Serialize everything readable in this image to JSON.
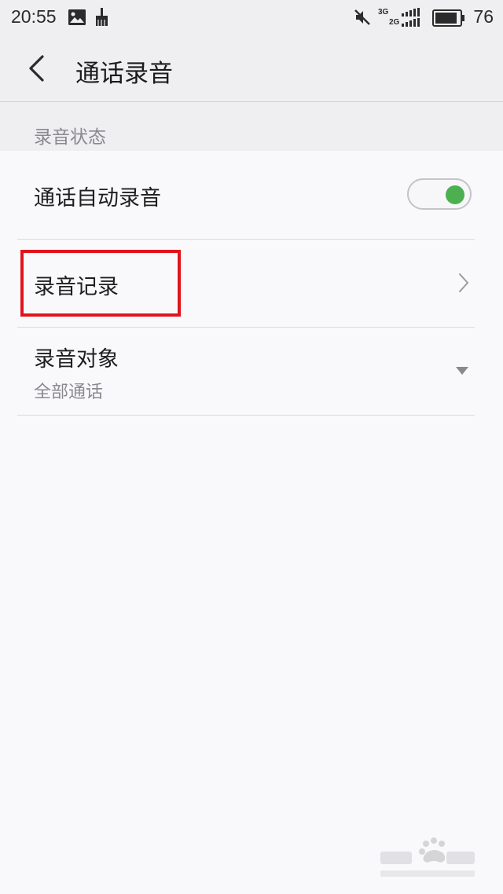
{
  "status_bar": {
    "time": "20:55",
    "battery_level": "76",
    "net_top": "3G",
    "net_bottom": "2G"
  },
  "header": {
    "title": "通话录音"
  },
  "section": {
    "title": "录音状态"
  },
  "rows": {
    "auto_record": {
      "label": "通话自动录音",
      "toggle_on": true
    },
    "records": {
      "label": "录音记录"
    },
    "target": {
      "label": "录音对象",
      "value": "全部通话"
    }
  },
  "colors": {
    "accent_toggle": "#4caf50",
    "highlight": "#e0141b",
    "background": "#f9f8fb",
    "header_background": "#efeef1"
  }
}
